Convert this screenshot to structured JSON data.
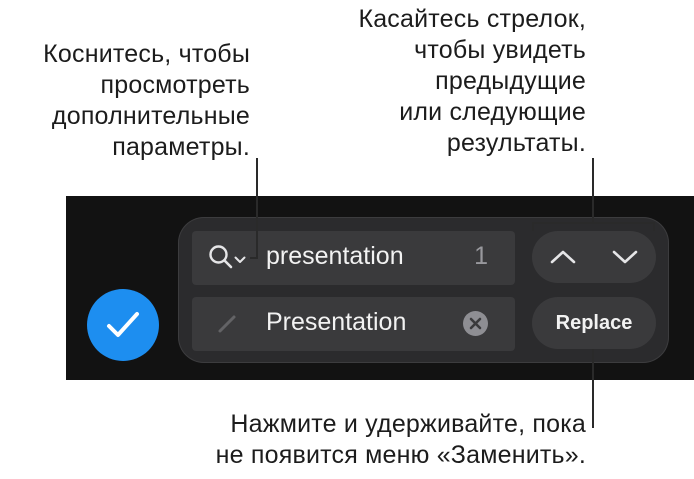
{
  "callouts": {
    "more_options": [
      "Коснитесь, чтобы",
      "просмотреть",
      "дополнительные",
      "параметры."
    ],
    "arrows": [
      "Касайтесь стрелок,",
      "чтобы увидеть",
      "предыдущие",
      "или следующие",
      "результаты."
    ],
    "replace_menu": [
      "Нажмите и удерживайте, пока",
      "не появится меню «Заменить»."
    ]
  },
  "find": {
    "query": "presentation",
    "match_count": "1",
    "icon": "search-icon"
  },
  "replace": {
    "value": "Presentation",
    "icon": "pencil-icon",
    "clear_icon": "clear-icon"
  },
  "buttons": {
    "replace_label": "Replace",
    "prev_icon": "chevron-up-icon",
    "next_icon": "chevron-down-icon",
    "confirm_icon": "checkmark-icon"
  },
  "colors": {
    "accent": "#1d8ef0",
    "toolbar_bg": "#121212",
    "panel_bg": "#2b2b2d",
    "field_bg": "#3a3a3c"
  }
}
